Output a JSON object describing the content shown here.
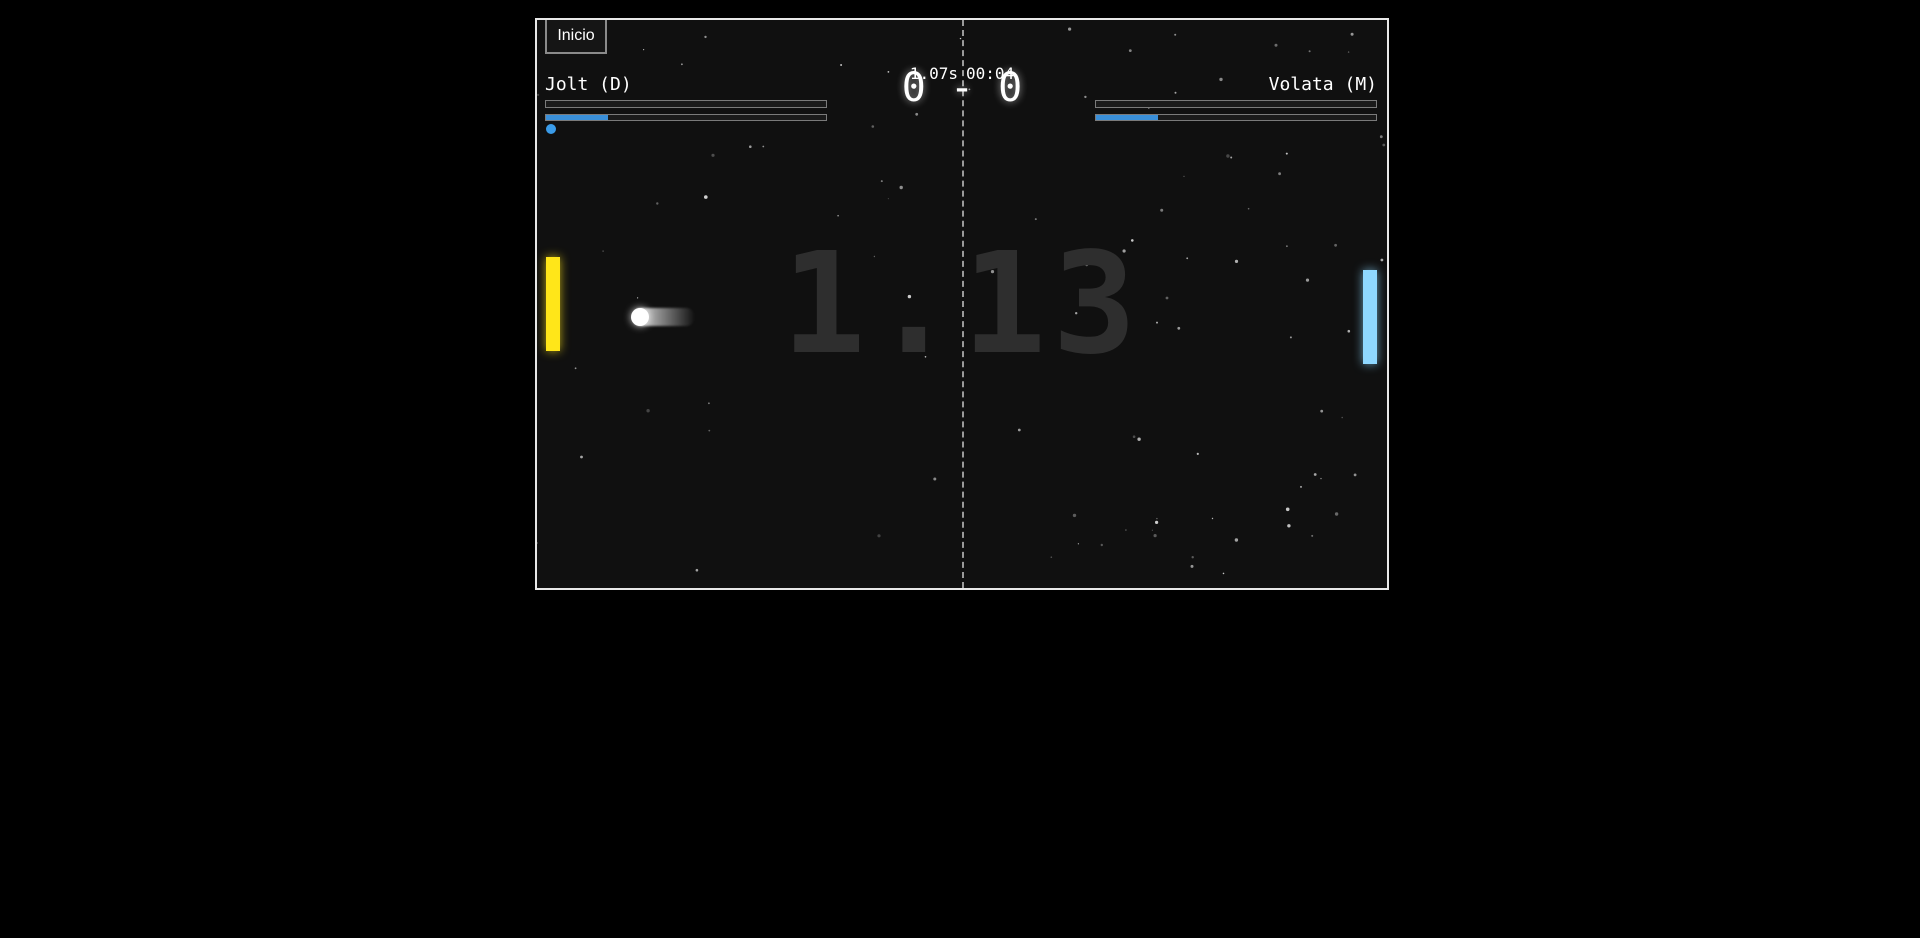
{
  "menu": {
    "start_label": "Inicio"
  },
  "players": {
    "left": {
      "name": "Jolt (D)",
      "health_fraction": 0,
      "energy_fraction": 0.22,
      "paddle_color": "#ffe619",
      "token_color": "#3a9be8"
    },
    "right": {
      "name": "Volata (M)",
      "health_fraction": 0,
      "energy_fraction": 0.22,
      "paddle_color": "#8fd8ff"
    }
  },
  "match": {
    "score_text": "0 - 0",
    "elapsed_seconds": "1.07s",
    "clock": "00:04",
    "big_timer": "1.13"
  },
  "colors": {
    "background": "#000000",
    "arena": "#101010",
    "bar_fill": "#3a8fd8"
  }
}
